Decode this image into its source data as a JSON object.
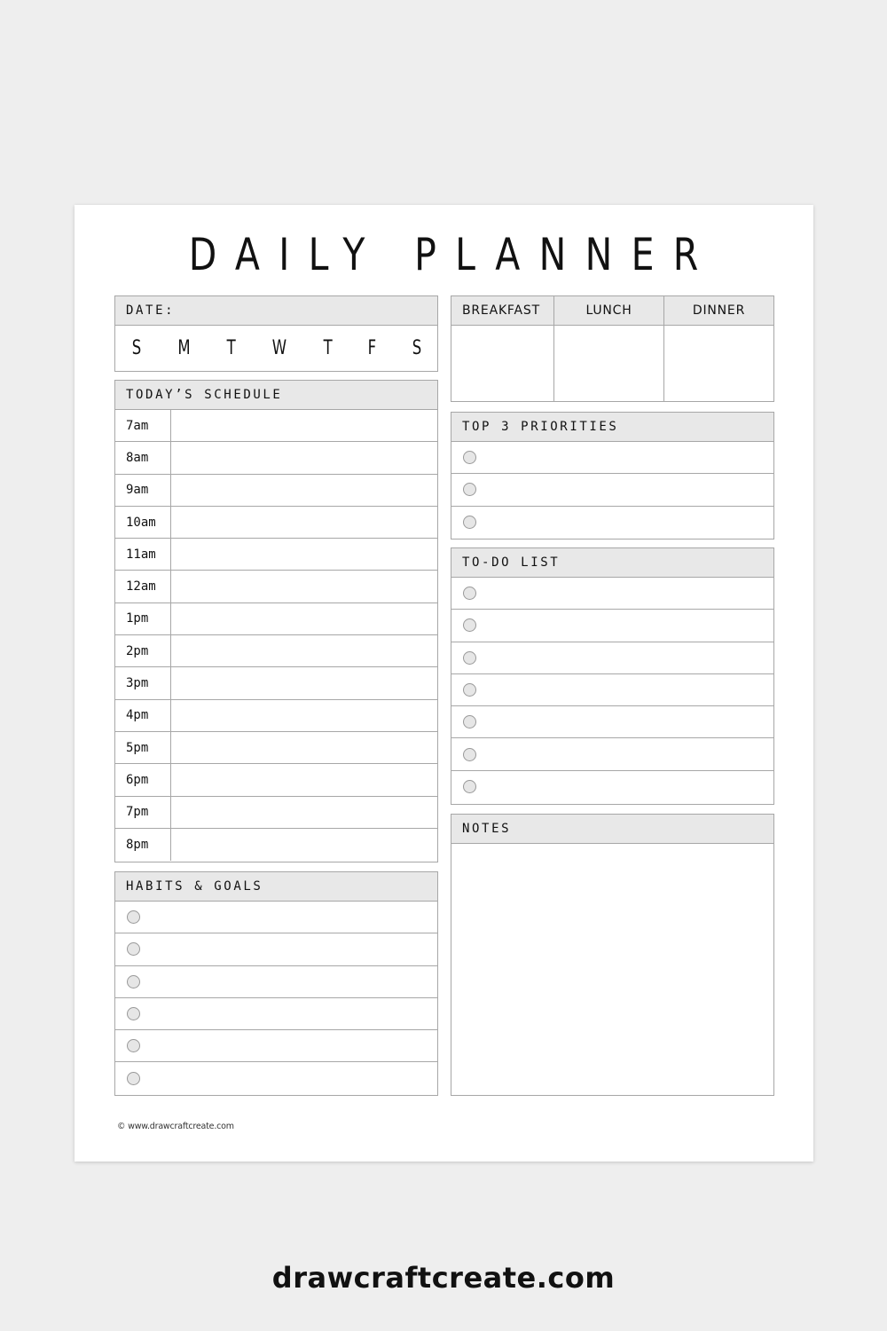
{
  "title": "DAILY PLANNER",
  "date": {
    "label": "DATE:",
    "days": [
      "S",
      "M",
      "T",
      "W",
      "T",
      "F",
      "S"
    ]
  },
  "schedule": {
    "label": "TODAY’S SCHEDULE",
    "times": [
      "7am",
      "8am",
      "9am",
      "10am",
      "11am",
      "12am",
      "1pm",
      "2pm",
      "3pm",
      "4pm",
      "5pm",
      "6pm",
      "7pm",
      "8pm"
    ]
  },
  "habits": {
    "label": "HABITS & GOALS",
    "count": 6
  },
  "meals": {
    "columns": [
      "BREAKFAST",
      "LUNCH",
      "DINNER"
    ]
  },
  "priorities": {
    "label": "TOP 3 PRIORITIES",
    "count": 3
  },
  "todo": {
    "label": "TO-DO LIST",
    "count": 7
  },
  "notes": {
    "label": "NOTES"
  },
  "footer": {
    "copyright": "© www.drawcraftcreate.com",
    "brand": "drawcraftcreate.com"
  }
}
